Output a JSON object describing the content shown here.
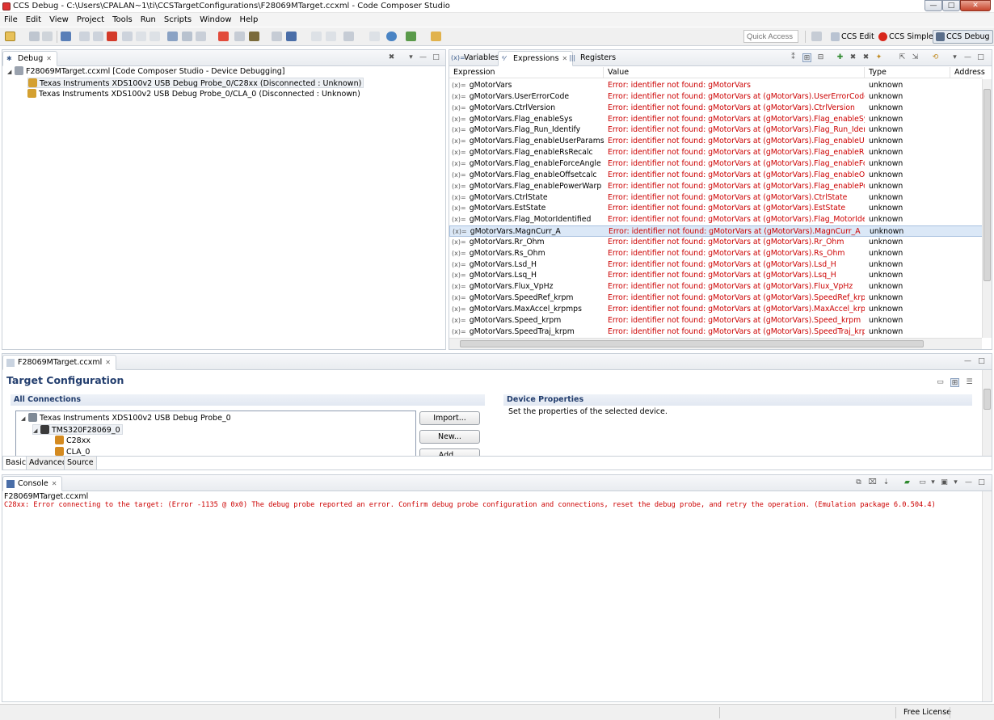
{
  "window": {
    "title": "CCS Debug - C:\\Users\\CPALAN~1\\ti\\CCSTargetConfigurations\\F28069MTarget.ccxml - Code Composer Studio",
    "minimize": "—",
    "maximize": "□",
    "close": "✕"
  },
  "menu": [
    "File",
    "Edit",
    "View",
    "Project",
    "Tools",
    "Run",
    "Scripts",
    "Window",
    "Help"
  ],
  "toolbar": {
    "quick_access_placeholder": "Quick Access",
    "perspectives": [
      {
        "label": "CCS Edit",
        "icon": "ccs-edit-icon"
      },
      {
        "label": "CCS Simple",
        "icon": "ccs-simple-icon"
      },
      {
        "label": "CCS Debug",
        "icon": "ccs-debug-icon"
      }
    ]
  },
  "debug_view": {
    "tab": "Debug",
    "root": "F28069MTarget.ccxml [Code Composer Studio - Device Debugging]",
    "children": [
      "Texas Instruments XDS100v2 USB Debug Probe_0/C28xx (Disconnected : Unknown)",
      "Texas Instruments XDS100v2 USB Debug Probe_0/CLA_0 (Disconnected : Unknown)"
    ]
  },
  "expressions_view": {
    "tabs": [
      {
        "label": "Variables",
        "icon": "(x)="
      },
      {
        "label": "Expressions",
        "icon": "⁶⁄"
      },
      {
        "label": "Registers",
        "icon": "|||"
      }
    ],
    "columns": [
      "Expression",
      "Value",
      "Type",
      "Address"
    ],
    "rows": [
      {
        "expr": "gMotorVars",
        "value": "Error: identifier not found: gMotorVars",
        "type": "unknown"
      },
      {
        "expr": "gMotorVars.UserErrorCode",
        "value": "Error: identifier not found: gMotorVars at (gMotorVars).UserErrorCode",
        "type": "unknown"
      },
      {
        "expr": "gMotorVars.CtrlVersion",
        "value": "Error: identifier not found: gMotorVars at (gMotorVars).CtrlVersion",
        "type": "unknown"
      },
      {
        "expr": "gMotorVars.Flag_enableSys",
        "value": "Error: identifier not found: gMotorVars at (gMotorVars).Flag_enableSys",
        "type": "unknown"
      },
      {
        "expr": "gMotorVars.Flag_Run_Identify",
        "value": "Error: identifier not found: gMotorVars at (gMotorVars).Flag_Run_Identify",
        "type": "unknown"
      },
      {
        "expr": "gMotorVars.Flag_enableUserParams",
        "value": "Error: identifier not found: gMotorVars at (gMotorVars).Flag_enableUserPara...",
        "type": "unknown"
      },
      {
        "expr": "gMotorVars.Flag_enableRsRecalc",
        "value": "Error: identifier not found: gMotorVars at (gMotorVars).Flag_enableRsRecalc",
        "type": "unknown"
      },
      {
        "expr": "gMotorVars.Flag_enableForceAngle",
        "value": "Error: identifier not found: gMotorVars at (gMotorVars).Flag_enableForceAn...",
        "type": "unknown"
      },
      {
        "expr": "gMotorVars.Flag_enableOffsetcalc",
        "value": "Error: identifier not found: gMotorVars at (gMotorVars).Flag_enableOffsetcalc",
        "type": "unknown"
      },
      {
        "expr": "gMotorVars.Flag_enablePowerWarp",
        "value": "Error: identifier not found: gMotorVars at (gMotorVars).Flag_enablePowerWa...",
        "type": "unknown"
      },
      {
        "expr": "gMotorVars.CtrlState",
        "value": "Error: identifier not found: gMotorVars at (gMotorVars).CtrlState",
        "type": "unknown"
      },
      {
        "expr": "gMotorVars.EstState",
        "value": "Error: identifier not found: gMotorVars at (gMotorVars).EstState",
        "type": "unknown"
      },
      {
        "expr": "gMotorVars.Flag_MotorIdentified",
        "value": "Error: identifier not found: gMotorVars at (gMotorVars).Flag_MotorIdentified",
        "type": "unknown"
      },
      {
        "expr": "gMotorVars.MagnCurr_A",
        "value": "Error: identifier not found: gMotorVars at (gMotorVars).MagnCurr_A",
        "type": "unknown"
      },
      {
        "expr": "gMotorVars.Rr_Ohm",
        "value": "Error: identifier not found: gMotorVars at (gMotorVars).Rr_Ohm",
        "type": "unknown"
      },
      {
        "expr": "gMotorVars.Rs_Ohm",
        "value": "Error: identifier not found: gMotorVars at (gMotorVars).Rs_Ohm",
        "type": "unknown"
      },
      {
        "expr": "gMotorVars.Lsd_H",
        "value": "Error: identifier not found: gMotorVars at (gMotorVars).Lsd_H",
        "type": "unknown"
      },
      {
        "expr": "gMotorVars.Lsq_H",
        "value": "Error: identifier not found: gMotorVars at (gMotorVars).Lsq_H",
        "type": "unknown"
      },
      {
        "expr": "gMotorVars.Flux_VpHz",
        "value": "Error: identifier not found: gMotorVars at (gMotorVars).Flux_VpHz",
        "type": "unknown"
      },
      {
        "expr": "gMotorVars.SpeedRef_krpm",
        "value": "Error: identifier not found: gMotorVars at (gMotorVars).SpeedRef_krpm",
        "type": "unknown"
      },
      {
        "expr": "gMotorVars.MaxAccel_krpmps",
        "value": "Error: identifier not found: gMotorVars at (gMotorVars).MaxAccel_krpmps",
        "type": "unknown"
      },
      {
        "expr": "gMotorVars.Speed_krpm",
        "value": "Error: identifier not found: gMotorVars at (gMotorVars).Speed_krpm",
        "type": "unknown"
      },
      {
        "expr": "gMotorVars.SpeedTraj_krpm",
        "value": "Error: identifier not found: gMotorVars at (gMotorVars).SpeedTraj_krpm",
        "type": "unknown"
      }
    ],
    "selected_row": 13
  },
  "target_config": {
    "tab": "F28069MTarget.ccxml",
    "title": "Target Configuration",
    "all_connections": "All Connections",
    "tree": {
      "probe": "Texas Instruments XDS100v2 USB Debug Probe_0",
      "device": "TMS320F28069_0",
      "cores": [
        "C28xx",
        "CLA_0"
      ]
    },
    "buttons": {
      "import": "Import...",
      "new": "New...",
      "add": "Add..."
    },
    "device_properties": {
      "title": "Device Properties",
      "text": "Set the properties of the selected device."
    },
    "bottom_tabs": [
      "Basic",
      "Advanced",
      "Source"
    ]
  },
  "console": {
    "tab": "Console",
    "source": "F28069MTarget.ccxml",
    "message": "C28xx: Error connecting to the target: (Error -1135 @ 0x0) The debug probe reported an error. Confirm debug probe configuration and connections, reset the debug probe, and retry the operation. (Emulation package 6.0.504.4)"
  },
  "status": {
    "license": "Free License"
  },
  "colors": {
    "error": "#cc0000",
    "selection": "#dbe8f7",
    "accent": "#233e6e"
  }
}
